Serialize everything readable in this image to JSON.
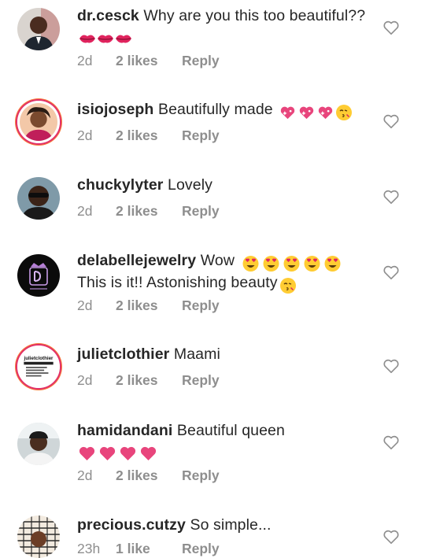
{
  "comments": [
    {
      "username": "dr.cesck",
      "text": "Why are you this too beautiful??",
      "emojis": [
        "kiss-lips",
        "kiss-lips",
        "kiss-lips"
      ],
      "time": "2d",
      "likes": "2 likes",
      "reply": "Reply",
      "avatar": "avatar-man-suit"
    },
    {
      "username": "isiojoseph",
      "text": "Beautifully made",
      "emojis": [
        "sparkling-heart",
        "sparkling-heart",
        "sparkling-heart",
        "face-blowing-kiss"
      ],
      "time": "2d",
      "likes": "2 likes",
      "reply": "Reply",
      "avatar": "avatar-woman-story-ring"
    },
    {
      "username": "chuckylyter",
      "text": "Lovely",
      "emojis": [],
      "time": "2d",
      "likes": "2 likes",
      "reply": "Reply",
      "avatar": "avatar-man-sunglasses"
    },
    {
      "username": "delabellejewelry",
      "text_line1": "Wow",
      "text_line2": "This is it!! Astonishing beauty",
      "emojis": [
        "heart-eyes",
        "heart-eyes",
        "heart-eyes",
        "heart-eyes",
        "heart-eyes"
      ],
      "emojis_line2": [
        "face-blowing-kiss"
      ],
      "time": "2d",
      "likes": "2 likes",
      "reply": "Reply",
      "avatar": "avatar-dj-logo"
    },
    {
      "username": "julietclothier",
      "text": "Maami",
      "emojis": [],
      "time": "2d",
      "likes": "2 likes",
      "reply": "Reply",
      "avatar": "avatar-julietclothier-card",
      "avatar_logo_text": "julietclothier"
    },
    {
      "username": "hamidandani",
      "text": "Beautiful queen",
      "emojis_line2": [
        "pink-heart",
        "pink-heart",
        "pink-heart",
        "pink-heart"
      ],
      "time": "2d",
      "likes": "2 likes",
      "reply": "Reply",
      "avatar": "avatar-man-cap"
    },
    {
      "username": "precious.cutzy",
      "text": "So simple...",
      "emojis": [],
      "time": "23h",
      "likes": "1 like",
      "reply": "Reply",
      "avatar": "avatar-pattern"
    }
  ],
  "like_button_icon": "heart-outline-icon",
  "colors": {
    "primary_text": "#262626",
    "secondary_text": "#8e8e8e",
    "story_ring": "#e1306c",
    "heart_pink": "#e8457c"
  }
}
